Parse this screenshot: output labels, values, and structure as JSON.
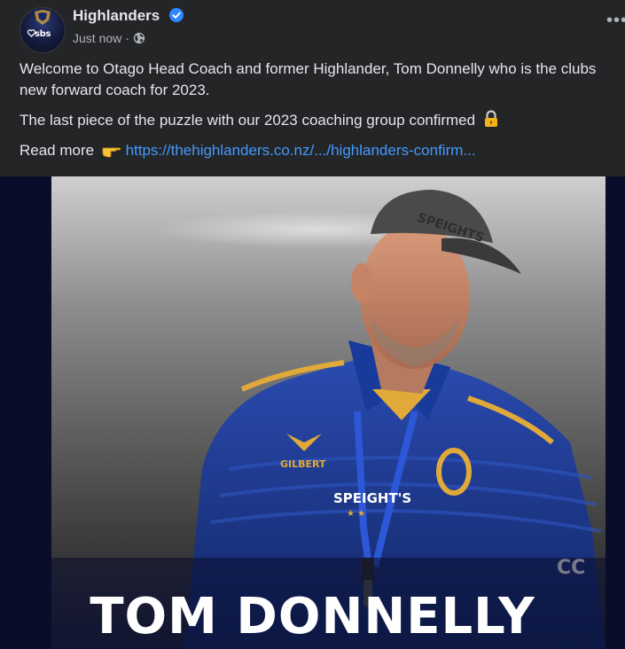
{
  "post": {
    "page_name": "Highlanders",
    "timestamp": "Just now",
    "separator": "·",
    "avatar_text": "sbs",
    "paragraphs": {
      "p1": "Welcome to Otago Head Coach and former Highlander, Tom Donnelly who is the clubs new forward coach for 2023.",
      "p2": "The last piece of the puzzle with our 2023 coaching group confirmed",
      "p3_prefix": "Read more",
      "p3_link": "https://thehighlanders.co.nz/.../highlanders-confirm..."
    },
    "more_label": "•••"
  },
  "image": {
    "caption_overlay": "TOM DONNELLY",
    "cap_text": "SPEIGHTS",
    "shirt_sponsor": "SPEIGHT'S",
    "shirt_brand": "GILBERT",
    "sleeve_text": "CC"
  },
  "colors": {
    "background": "#242526",
    "link": "#4599ff",
    "verified": "#2d88ff",
    "jersey": "#1c3a8c",
    "stripe": "#e0a93a"
  },
  "icons": {
    "verified": "verified-badge-icon",
    "privacy": "globe-icon",
    "lock": "lock-emoji-icon",
    "pointer": "pointing-hand-emoji-icon",
    "more": "more-options-icon"
  }
}
